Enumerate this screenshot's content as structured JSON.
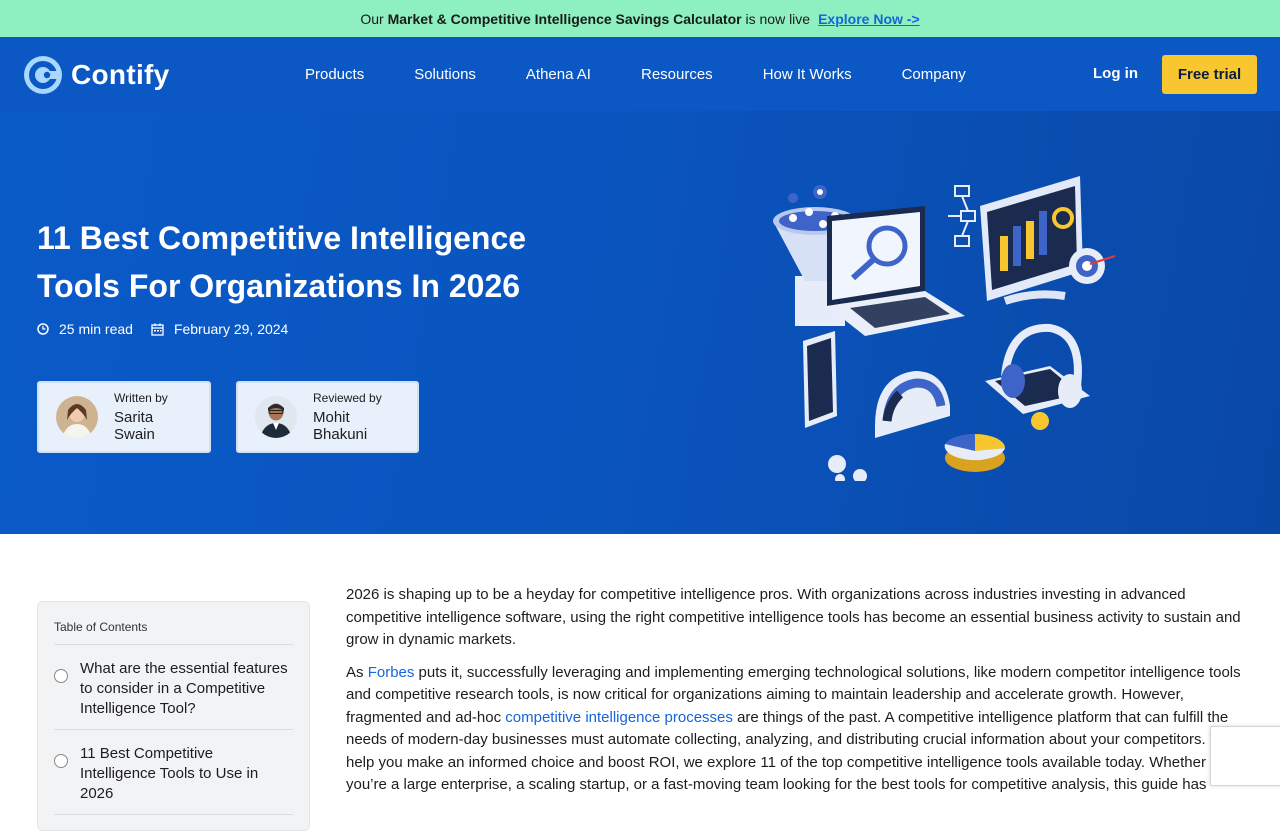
{
  "announcement": {
    "prefix": "Our",
    "bold": "Market & Competitive Intelligence Savings Calculator",
    "suffix": "is now live",
    "link": "Explore Now ->"
  },
  "nav": {
    "brand": "Contify",
    "menu": [
      "Products",
      "Solutions",
      "Athena AI",
      "Resources",
      "How It Works",
      "Company"
    ],
    "login": "Log in",
    "cta": "Free trial"
  },
  "hero": {
    "title": "11 Best Competitive Intelligence Tools For Organizations In 2026",
    "read_time": "25 min read",
    "date": "February 29, 2024",
    "author": {
      "label": "Written by",
      "name": "Sarita Swain"
    },
    "reviewer": {
      "label": "Reviewed by",
      "name": "Mohit Bhakuni"
    }
  },
  "toc": {
    "title": "Table of Contents",
    "items": [
      "What are the essential features to consider in a Competitive Intelligence Tool?",
      "11 Best Competitive Intelligence Tools to Use in 2026"
    ]
  },
  "article": {
    "p1": "2026 is shaping up to be a heyday for competitive intelligence pros. With organizations across industries investing in advanced competitive intelligence software, using the right competitive intelligence tools has become an essential business activity to sustain and grow in dynamic markets.",
    "p2_a": "As ",
    "p2_link1": "Forbes",
    "p2_b": " puts it, successfully leveraging and implementing emerging technological solutions, like modern competitor intelligence tools and competitive research tools, is now critical for organizations aiming to maintain leadership and accelerate growth. However, fragmented and ad-hoc ",
    "p2_link2": "competitive intelligence processes",
    "p2_c": " are things of the past. A competitive intelligence platform that can fulfill the needs of modern-day businesses must automate collecting, analyzing, and distributing crucial information about your competitors. To help you make an informed choice and boost ROI, we explore 11 of the top competitive intelligence tools available today. Whether you’re a large enterprise, a scaling startup, or a fast-moving team looking for the best tools for competitive analysis, this guide has"
  },
  "colors": {
    "announce_bg": "#8ef0c1",
    "nav_bg": "#0b57c4",
    "cta": "#f8c62f",
    "link": "#1565d8"
  }
}
